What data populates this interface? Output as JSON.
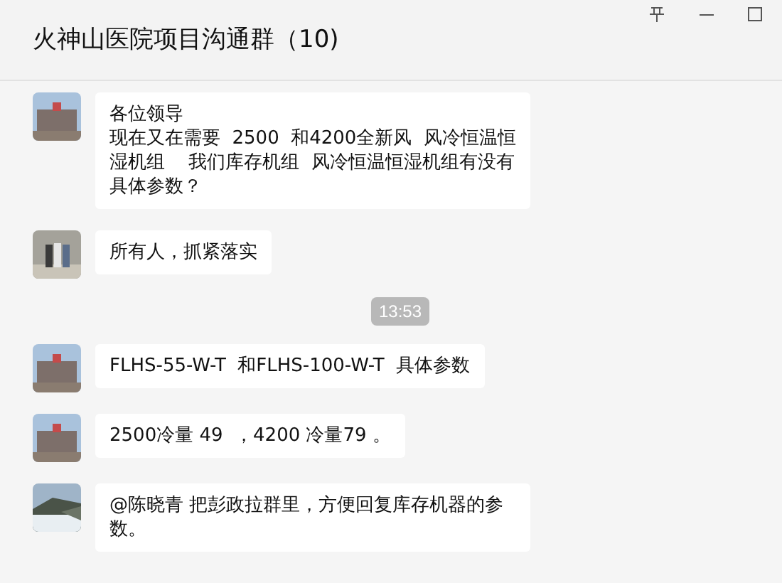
{
  "window": {
    "title": "火神山医院项目沟通群（10)"
  },
  "messages": [
    {
      "kind": "message",
      "lines": [
        "各位领导",
        "现在又在需要  2500  和4200全新风  风冷恒温恒湿机组    我们库存机组  风冷恒温恒湿机组有没有具体参数？"
      ]
    },
    {
      "kind": "message",
      "text": "所有人，抓紧落实"
    },
    {
      "kind": "time",
      "text": "13:53"
    },
    {
      "kind": "message",
      "text": "FLHS-55-W-T  和FLHS-100-W-T  具体参数"
    },
    {
      "kind": "message",
      "text": "2500冷量 49  ，4200 冷量79 。"
    },
    {
      "kind": "message",
      "text": "@陈晓青 把彭政拉群里，方便回复库存机器的参数。"
    }
  ]
}
